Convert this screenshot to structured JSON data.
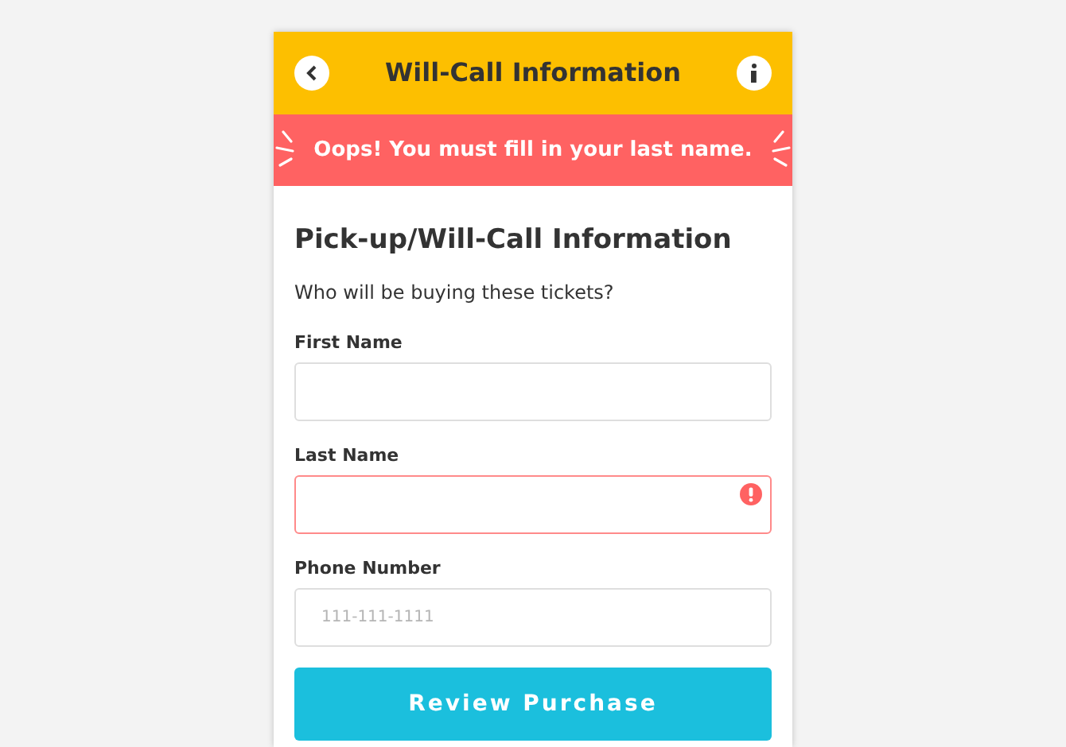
{
  "header": {
    "title": "Will-Call Information"
  },
  "alert": {
    "message": "Oops! You must fill in your last name."
  },
  "form": {
    "heading": "Pick-up/Will-Call Information",
    "prompt": "Who will be buying these tickets?",
    "fields": [
      {
        "label": "First Name",
        "error": false
      },
      {
        "label": "Last Name",
        "error": true
      },
      {
        "label": "Phone Number",
        "error": false,
        "placeholder": "111-111-1111"
      }
    ],
    "submit": "Review Purchase"
  }
}
